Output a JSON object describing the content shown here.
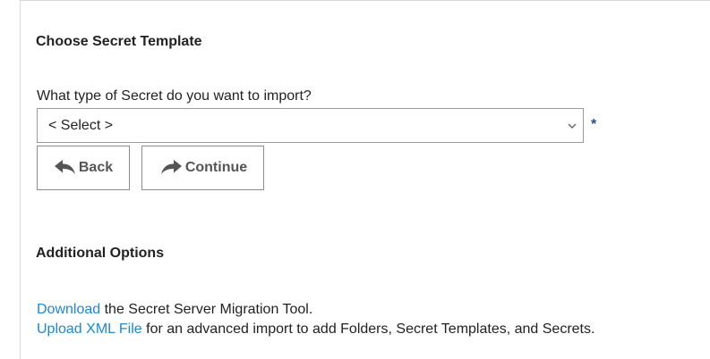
{
  "choose_template": {
    "title": "Choose Secret Template",
    "question": "What type of Secret do you want to import?",
    "select": {
      "value": "< Select >"
    },
    "required_marker": "*",
    "back_label": "Back",
    "continue_label": "Continue"
  },
  "additional_options": {
    "title": "Additional Options",
    "download": {
      "link_text": "Download",
      "rest_text": " the Secret Server Migration Tool."
    },
    "upload": {
      "link_text": "Upload XML File",
      "rest_text": " for an advanced import to add Folders, Secret Templates, and Secrets."
    }
  },
  "icons": {
    "back": "reply-arrow-icon",
    "continue": "forward-arrow-icon",
    "select_chevron": "chevron-down-icon"
  },
  "colors": {
    "link": "#1e88d0",
    "required": "#1f4e9b",
    "button_text": "#555555",
    "border": "#9a9a9a"
  }
}
